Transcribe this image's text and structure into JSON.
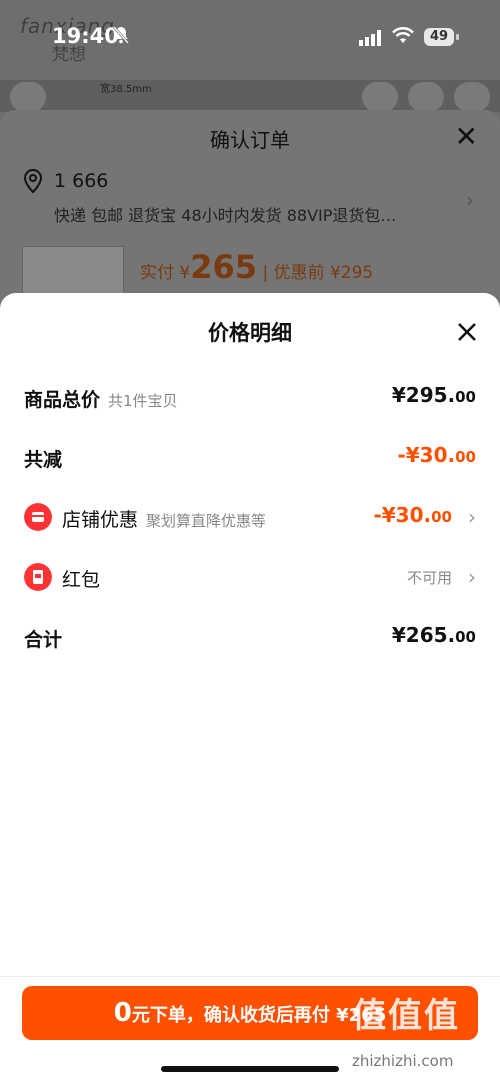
{
  "status": {
    "time": "19:40",
    "battery": "49"
  },
  "background": {
    "logo": "fanxiang",
    "logo_sub": "梵想",
    "ruler": "宽38.5mm"
  },
  "confirm": {
    "title": "确认订单",
    "address": "1 666",
    "shipping": "快递 包邮 退货宝 48小时内发货 88VIP退货包…",
    "paid_label": "实付 ¥",
    "paid_amount": "265",
    "before_label": "| 优惠前 ¥295"
  },
  "detail": {
    "title": "价格明细",
    "rows": [
      {
        "label": "商品总价",
        "sub": "共1件宝贝",
        "amount_main": "¥295.",
        "amount_dec": "00"
      },
      {
        "label": "共减",
        "sub": "",
        "amount_main": "-¥30.",
        "amount_dec": "00"
      },
      {
        "label": "店铺优惠",
        "sub": "聚划算直降优惠等",
        "amount_main": "-¥30.",
        "amount_dec": "00"
      },
      {
        "label": "红包",
        "sub": "",
        "status": "不可用"
      },
      {
        "label": "合计",
        "sub": "",
        "amount_main": "¥265.",
        "amount_dec": "00"
      }
    ]
  },
  "cta": {
    "prefix": "0",
    "text": "元下单，确认收货后再付 ¥265"
  },
  "watermark": {
    "main": "值",
    "url": "zhizhizhi.com"
  },
  "colors": {
    "accent": "#ff5000",
    "badge": "#ff3333"
  }
}
